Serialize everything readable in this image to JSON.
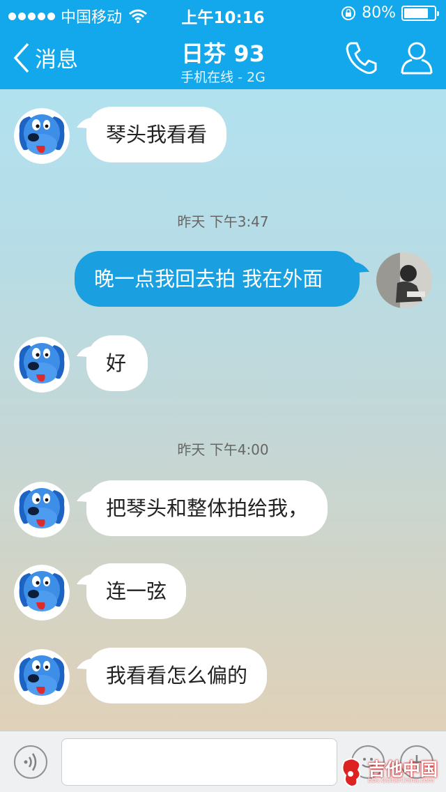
{
  "status": {
    "carrier": "中国移动",
    "time": "上午10:16",
    "battery": "80%",
    "battery_level": 0.8
  },
  "header": {
    "back_label": "消息",
    "title": "日芬 93",
    "subtitle": "手机在线 - 2G"
  },
  "messages": [
    {
      "side": "in",
      "text": "琴头我看看"
    },
    {
      "timestamp": "昨天 下午3:47"
    },
    {
      "side": "out",
      "text": "晚一点我回去拍 我在外面"
    },
    {
      "side": "in",
      "text": "好"
    },
    {
      "timestamp": "昨天 下午4:00"
    },
    {
      "side": "in",
      "text": "把琴头和整体拍给我，"
    },
    {
      "side": "in",
      "text": "连一弦"
    },
    {
      "side": "in",
      "text": "我看看怎么偏的"
    }
  ],
  "input": {
    "placeholder": "",
    "value": ""
  },
  "watermark": {
    "text": "吉他中国",
    "sub": "bbs.GuitarChina.com"
  },
  "colors": {
    "header": "#12a8eb",
    "outgoing_bubble": "#1aa0e0",
    "incoming_bubble": "#ffffff"
  },
  "icons": [
    "wifi-icon",
    "rotation-lock-icon",
    "battery-icon",
    "back-chevron-icon",
    "phone-icon",
    "profile-icon",
    "voice-icon",
    "emoji-icon",
    "plus-icon"
  ]
}
